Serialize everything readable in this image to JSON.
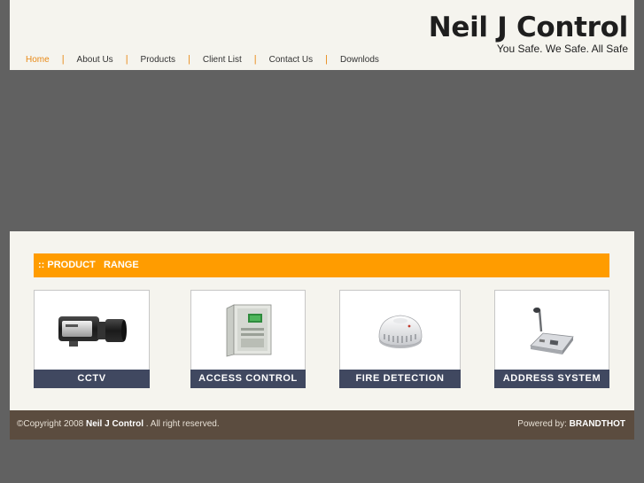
{
  "site": {
    "title": "Neil J Control",
    "tagline": "You Safe. We Safe. All Safe"
  },
  "nav": {
    "items": [
      {
        "label": "Home",
        "active": true
      },
      {
        "label": "About Us"
      },
      {
        "label": "Products"
      },
      {
        "label": "Client List"
      },
      {
        "label": "Contact Us"
      },
      {
        "label": "Downlods"
      }
    ]
  },
  "product_range": {
    "heading": ":: PRODUCT   RANGE",
    "products": [
      {
        "label": "CCTV",
        "icon": "cctv-camera-icon"
      },
      {
        "label": "ACCESS CONTROL",
        "icon": "access-control-panel-icon"
      },
      {
        "label": "FIRE DETECTION",
        "icon": "smoke-detector-icon"
      },
      {
        "label": "ADDRESS SYSTEM",
        "icon": "desk-microphone-icon"
      }
    ]
  },
  "footer": {
    "copyright_prefix": "©Copyright 2008",
    "company": "Neil J Control",
    "copyright_suffix": ". All right reserved.",
    "powered_prefix": "Powered by:",
    "powered_by": "BRANDTHOT"
  },
  "colors": {
    "accent_orange": "#ff9c00",
    "nav_active": "#e98a17",
    "label_bar": "#404860",
    "footer_bg": "#5b4c3f",
    "page_bg": "#616161"
  }
}
